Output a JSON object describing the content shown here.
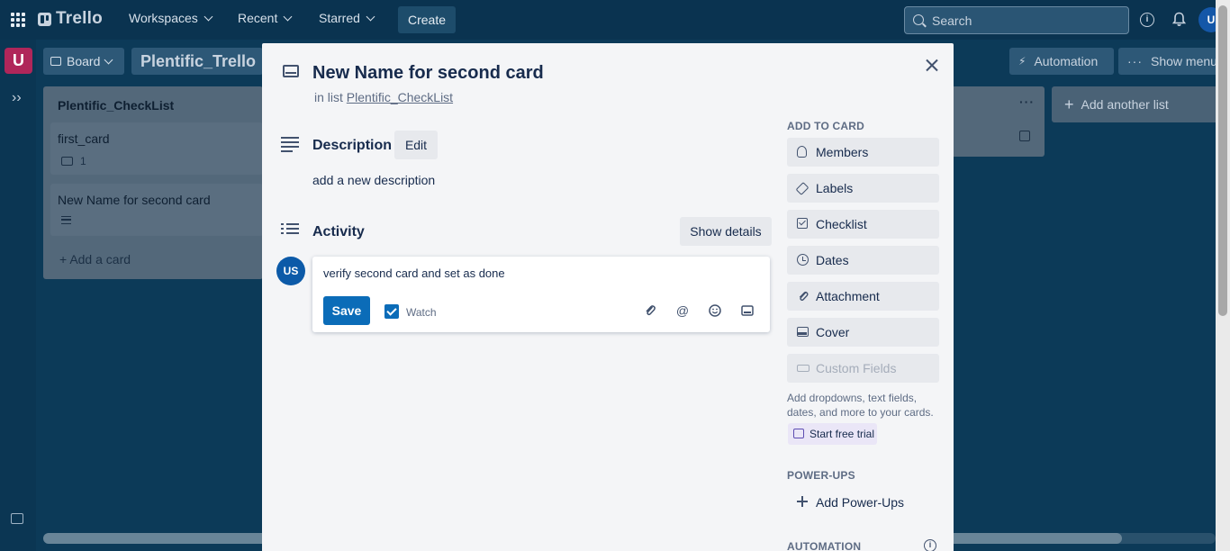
{
  "header": {
    "logo": "Trello",
    "nav": [
      "Workspaces",
      "Recent",
      "Starred"
    ],
    "create": "Create",
    "search_placeholder": "Search",
    "avatar_initial": "U"
  },
  "sidebar": {
    "workspace_initial": "U"
  },
  "board": {
    "view_label": "Board",
    "title": "Plentific_Trello",
    "automation": "Automation",
    "show_menu": "Show menu",
    "add_list": "Add another list"
  },
  "lists": [
    {
      "title": "Plentific_CheckList",
      "cards": [
        {
          "title": "first_card",
          "comments": "1"
        },
        {
          "title": "New Name for second card"
        }
      ],
      "add_card": "Add a card"
    }
  ],
  "modal": {
    "title": "New Name for second card",
    "in_list_prefix": "in list",
    "list_name": "Plentific_CheckList",
    "description": {
      "heading": "Description",
      "edit": "Edit",
      "text": "add a new description"
    },
    "activity": {
      "heading": "Activity",
      "show_details": "Show details",
      "avatar": "US",
      "comment_text": "verify second card and set as done",
      "save": "Save",
      "watch": "Watch",
      "watch_checked": true
    },
    "side": {
      "add_to_card": "ADD TO CARD",
      "buttons": [
        "Members",
        "Labels",
        "Checklist",
        "Dates",
        "Attachment",
        "Cover",
        "Custom Fields"
      ],
      "custom_fields_note": "Add dropdowns, text fields, dates, and more to your cards.",
      "trial": "Start free trial",
      "power_ups_heading": "POWER-UPS",
      "add_power_ups": "Add Power-Ups",
      "automation_heading": "AUTOMATION"
    }
  }
}
